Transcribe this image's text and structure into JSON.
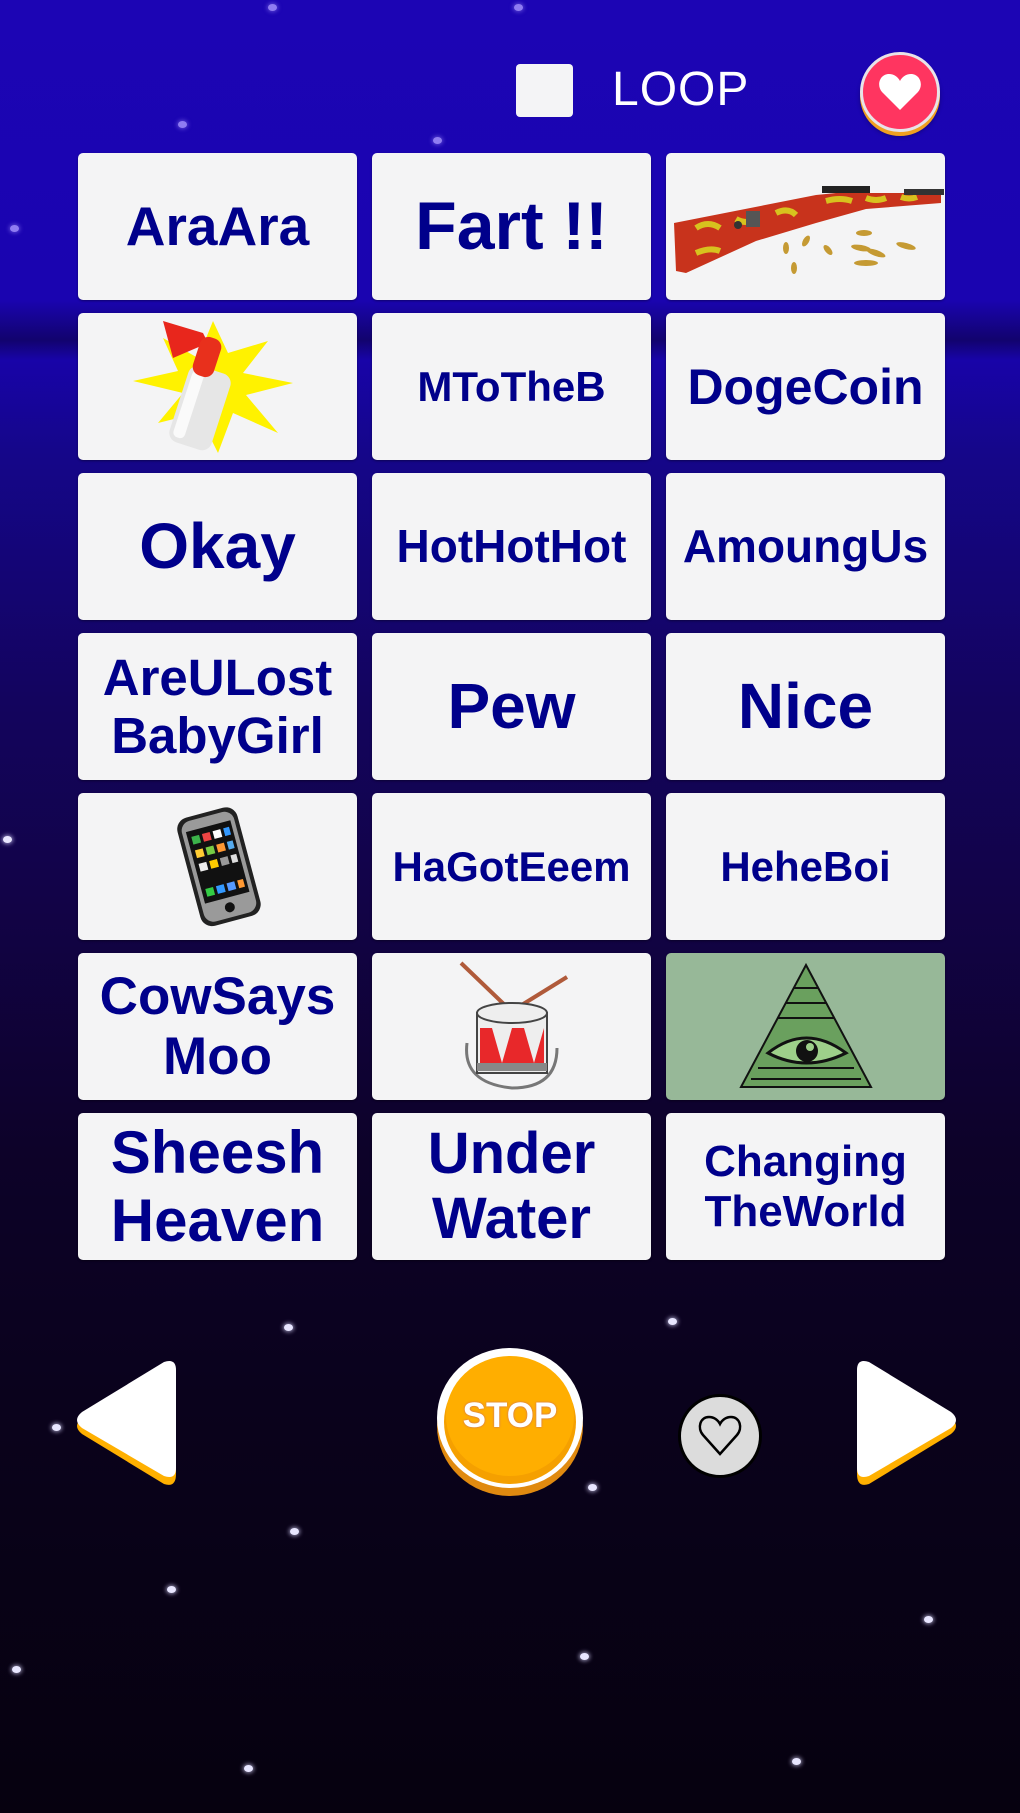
{
  "header": {
    "loop_label": "LOOP",
    "loop_checked": false,
    "favorites_icon": "heart-icon"
  },
  "colors": {
    "tile_text": "#00008b",
    "tile_bg": "#f4f4f5",
    "tile_bg_green": "#97b898",
    "stop_orange": "#ffae00",
    "favorite_red": "#ff3560"
  },
  "sounds": [
    {
      "label": "AraAra",
      "type": "text"
    },
    {
      "label": "Fart !!",
      "type": "text"
    },
    {
      "label": "",
      "type": "image",
      "icon": "rifle-icon"
    },
    {
      "label": "",
      "type": "image",
      "icon": "air-horn-icon"
    },
    {
      "label": "MToTheB",
      "type": "text"
    },
    {
      "label": "DogeCoin",
      "type": "text"
    },
    {
      "label": "Okay",
      "type": "text"
    },
    {
      "label": "HotHotHot",
      "type": "text"
    },
    {
      "label": "AmoungUs",
      "type": "text"
    },
    {
      "label": "AreULost\nBabyGirl",
      "type": "text"
    },
    {
      "label": "Pew",
      "type": "text"
    },
    {
      "label": "Nice",
      "type": "text"
    },
    {
      "label": "",
      "type": "image",
      "icon": "smartphone-icon"
    },
    {
      "label": "HaGotEeem",
      "type": "text"
    },
    {
      "label": "HeheBoi",
      "type": "text"
    },
    {
      "label": "CowSays\nMoo",
      "type": "text"
    },
    {
      "label": "",
      "type": "image",
      "icon": "drum-icon"
    },
    {
      "label": "",
      "type": "image",
      "icon": "illuminati-eye-icon"
    },
    {
      "label": "Sheesh\nHeaven",
      "type": "text"
    },
    {
      "label": "Under\nWater",
      "type": "text"
    },
    {
      "label": "Changing\nTheWorld",
      "type": "text"
    }
  ],
  "controls": {
    "prev_icon": "previous-page-arrow-icon",
    "stop_label": "STOP",
    "favorite_icon": "heart-outline-icon",
    "next_icon": "next-page-arrow-icon"
  }
}
